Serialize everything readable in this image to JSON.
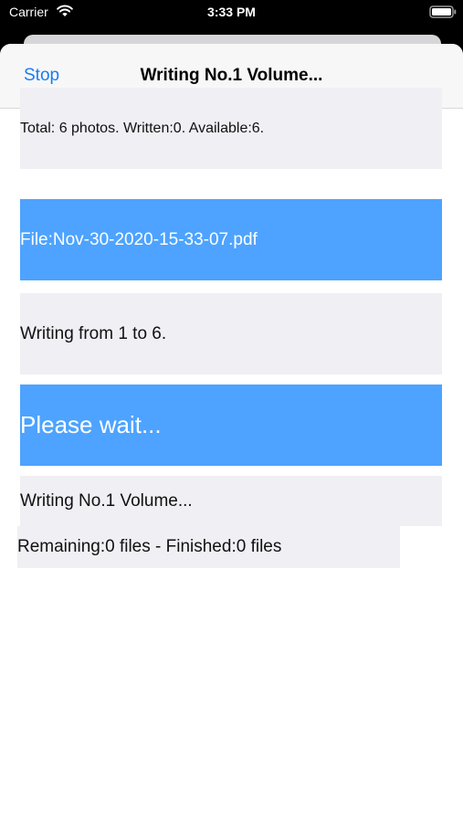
{
  "status_bar": {
    "carrier": "Carrier",
    "time": "3:33 PM",
    "wifi_icon": "wifi-icon",
    "battery_icon": "battery-icon"
  },
  "nav": {
    "stop_label": "Stop",
    "title": "Writing No.1 Volume..."
  },
  "content": {
    "total": "Total: 6 photos. Written:0. Available:6.",
    "file": "File:Nov-30-2020-15-33-07.pdf",
    "range": "Writing from 1 to 6.",
    "wait": "Please wait...",
    "volume": "Writing No.1 Volume...",
    "remaining": "Remaining:0 files - Finished:0 files"
  },
  "colors": {
    "accent": "#1a7cf5",
    "highlight_box": "#4da3ff",
    "gray_box": "#efeff4",
    "nav_background": "#f7f7f7",
    "status_background": "#000000"
  }
}
